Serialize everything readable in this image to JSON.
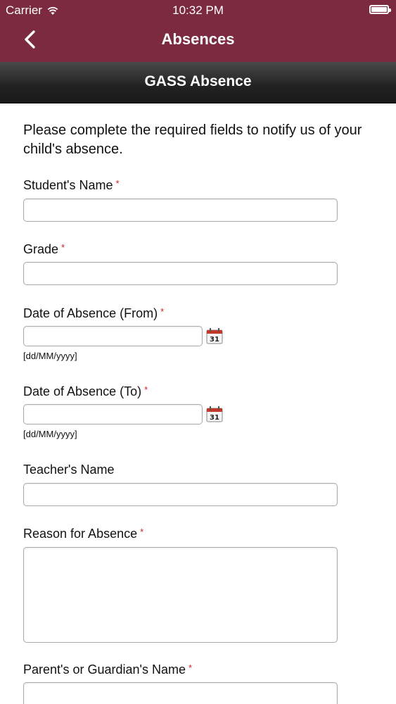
{
  "status_bar": {
    "carrier": "Carrier",
    "time": "10:32 PM"
  },
  "nav": {
    "title": "Absences",
    "back_icon": "chevron-left-icon"
  },
  "form": {
    "heading": "GASS Absence",
    "intro": "Please complete the required fields to notify us of your child's absence.",
    "required_marker": "*",
    "date_hint": "[dd/MM/yyyy]",
    "calendar_day": "31",
    "fields": {
      "student_name": {
        "label": "Student's Name",
        "value": ""
      },
      "grade": {
        "label": "Grade",
        "value": ""
      },
      "date_from": {
        "label": "Date of Absence (From)",
        "value": ""
      },
      "date_to": {
        "label": "Date of Absence (To)",
        "value": ""
      },
      "teacher_name": {
        "label": "Teacher's Name",
        "value": ""
      },
      "reason": {
        "label": "Reason for Absence",
        "value": ""
      },
      "guardian_name": {
        "label": "Parent's or Guardian's Name",
        "value": ""
      }
    }
  },
  "colors": {
    "brand": "#7b2a40",
    "subbar": "#222222",
    "required": "#cc2222"
  }
}
